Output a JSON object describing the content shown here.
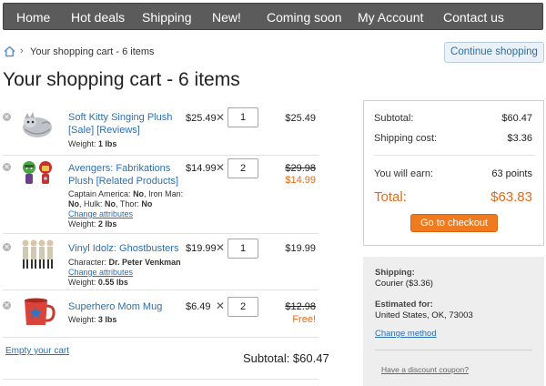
{
  "nav": {
    "items": [
      {
        "label": "Home"
      },
      {
        "label": "Hot deals"
      },
      {
        "label": "Shipping"
      },
      {
        "label": "New!"
      },
      {
        "label": "Coming soon"
      },
      {
        "label": "My Account"
      },
      {
        "label": "Contact us"
      }
    ]
  },
  "breadcrumb": {
    "separator": "›",
    "current": "Your shopping cart - 6 items"
  },
  "continue_button": "Continue shopping",
  "page_title": "Your shopping cart - 6 items",
  "cart": {
    "times_symbol": "✕",
    "items": [
      {
        "name": "Soft Kitty Singing Plush [Sale] [Reviews]",
        "meta": [
          {
            "label": "Weight:",
            "value": "1 lbs"
          }
        ],
        "price": "$25.49",
        "qty": "1",
        "total": "$25.49"
      },
      {
        "name": "Avengers: Fabrikations Plush [Related Products]",
        "attributes": "Captain America: No, Iron Man: No, Hulk: No, Thor: No",
        "attr_parts": [
          {
            "label": "Captain America:",
            "value": "No"
          },
          {
            "label": "Iron Man:",
            "value": "No"
          },
          {
            "label": "Hulk:",
            "value": "No"
          },
          {
            "label": "Thor:",
            "value": "No"
          }
        ],
        "change_attributes": "Change attributes",
        "weight_label": "Weight:",
        "weight": "2 lbs",
        "price": "$14.99",
        "qty": "2",
        "old_total": "$29.98",
        "total": "$14.99"
      },
      {
        "name": "Vinyl Idolz: Ghostbusters",
        "character_label": "Character:",
        "character": "Dr. Peter Venkman",
        "change_attributes": "Change attributes",
        "weight_label": "Weight:",
        "weight": "0.55 lbs",
        "price": "$19.99",
        "qty": "1",
        "total": "$19.99"
      },
      {
        "name": "Superhero Mom Mug",
        "weight_label": "Weight:",
        "weight": "3 lbs",
        "price": "$6.49",
        "qty": "2",
        "old_total": "$12.98",
        "total": "Free!"
      }
    ],
    "empty_cart": "Empty your cart",
    "subtotal_text": "Subtotal: $60.47"
  },
  "summary": {
    "subtotal_label": "Subtotal:",
    "subtotal_value": "$60.47",
    "shipping_label": "Shipping cost:",
    "shipping_value": "$3.36",
    "earn_label": "You will earn:",
    "earn_value": "63 points",
    "total_label": "Total:",
    "total_value": "$63.83",
    "checkout_button": "Go to checkout"
  },
  "shipping": {
    "shipping_heading": "Shipping:",
    "shipping_method": "Courier ($3.36)",
    "estimated_heading": "Estimated for:",
    "estimated_value": "United States, OK, 73003",
    "change_method": "Change method",
    "discount_link": "Have a discount coupon?"
  },
  "colors": {
    "nav_bg": "#5b5b5b",
    "link": "#2c6fb0",
    "accent_orange": "#e46a1a",
    "checkout_orange": "#f07a1e"
  }
}
